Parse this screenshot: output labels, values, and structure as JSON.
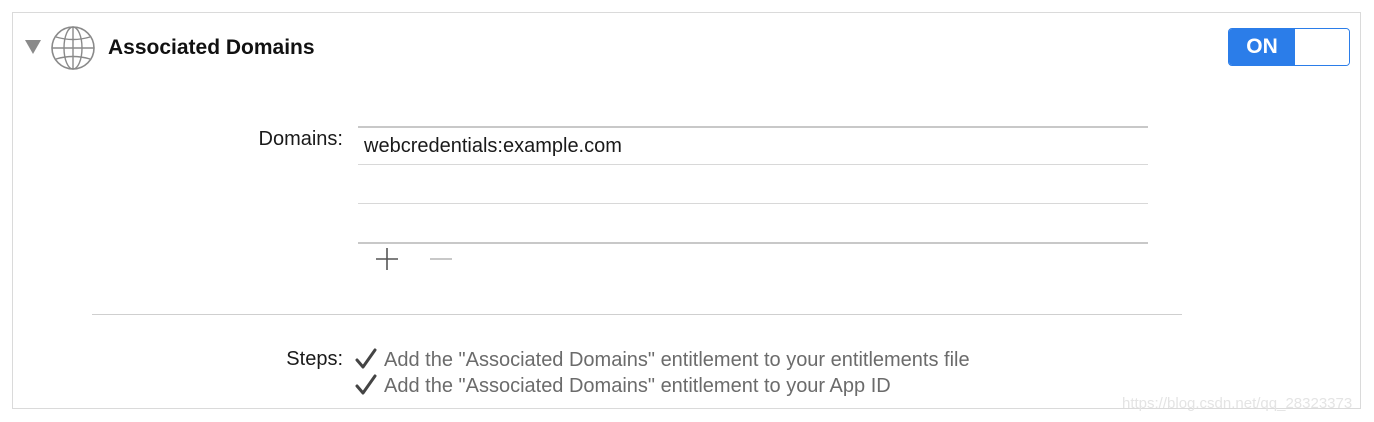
{
  "section": {
    "title": "Associated Domains",
    "icon": "globe-icon",
    "expanded": true
  },
  "toggle": {
    "state_label": "ON",
    "accent_color": "#2b7de9"
  },
  "domains": {
    "label": "Domains:",
    "entries": [
      "webcredentials:example.com",
      "",
      ""
    ]
  },
  "steps": {
    "label": "Steps:",
    "items": [
      "Add the \"Associated Domains\" entitlement to your entitlements file",
      "Add the \"Associated Domains\" entitlement to your App ID"
    ]
  },
  "watermark": "https://blog.csdn.net/qq_28323373"
}
